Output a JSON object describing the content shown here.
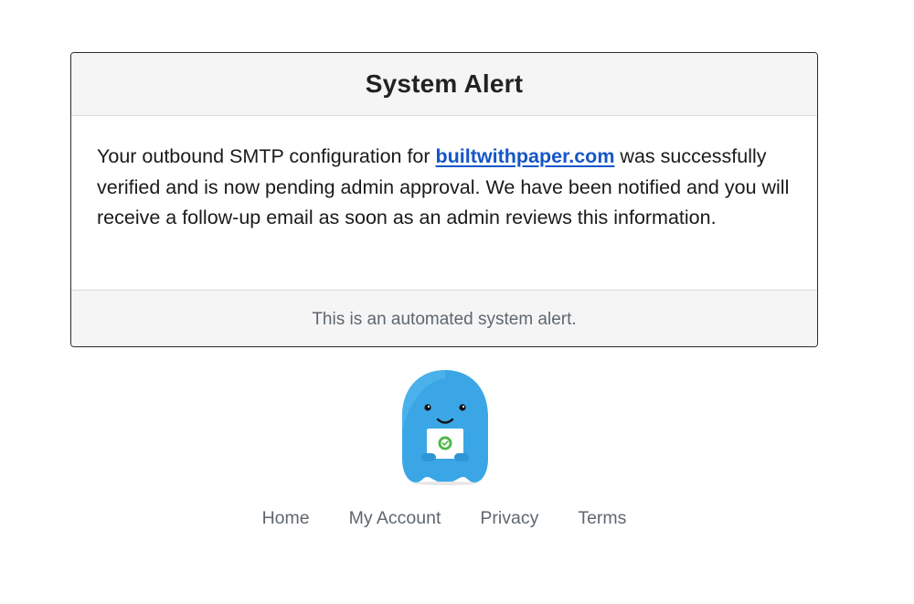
{
  "alert": {
    "title": "System Alert",
    "message_before": "Your outbound SMTP configuration for ",
    "domain_link": "builtwithpaper.com",
    "message_after": " was successfully verified and is now pending admin approval. We have been notified and you will receive a follow-up email as soon as an admin reviews this information.",
    "footer_text": "This is an automated system alert."
  },
  "mascot": {
    "icon": "blue-mascot-holding-verified-badge-icon",
    "body_color": "#3aa6e6",
    "badge_color": "#4cb848"
  },
  "nav": {
    "items": [
      {
        "label": "Home"
      },
      {
        "label": "My Account"
      },
      {
        "label": "Privacy"
      },
      {
        "label": "Terms"
      }
    ]
  },
  "colors": {
    "link": "#1456c8",
    "muted_text": "#5e6770",
    "panel_bg": "#f5f5f5"
  }
}
